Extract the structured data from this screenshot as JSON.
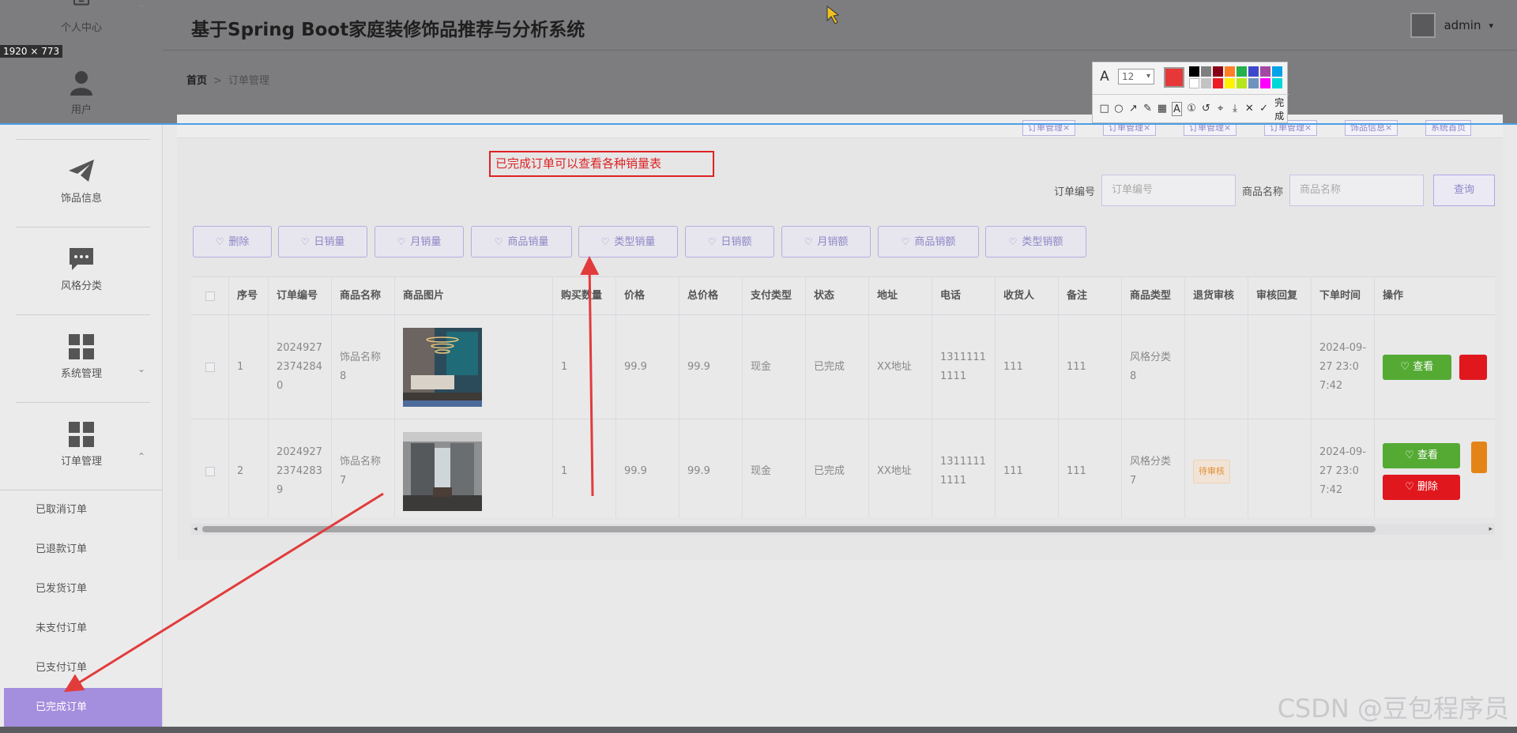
{
  "app": {
    "title": "基于Spring Boot家庭装修饰品推荐与分析系统",
    "user": "admin",
    "size_badge": "1920 × 773"
  },
  "breadcrumb": {
    "home": "首页",
    "separator": ">",
    "current": "订单管理"
  },
  "sidebar": {
    "items": [
      {
        "label": "个人中心",
        "icon": "monitor-icon"
      },
      {
        "label": "用户",
        "icon": "user-icon"
      },
      {
        "label": "饰品信息",
        "icon": "paper-plane-icon"
      },
      {
        "label": "风格分类",
        "icon": "chat-bubble-icon"
      },
      {
        "label": "系统管理",
        "icon": "grid-icon"
      },
      {
        "label": "订单管理",
        "icon": "grid-icon"
      }
    ],
    "sub_items": [
      "已取消订单",
      "已退款订单",
      "已发货订单",
      "未支付订单",
      "已支付订单",
      "已完成订单"
    ],
    "active_sub": "已完成订单"
  },
  "tabs": [
    "订单管理×",
    "订单管理×",
    "订单管理×",
    "订单管理×",
    "饰品信息×",
    "系统首页"
  ],
  "search": {
    "order_label": "订单编号",
    "order_placeholder": "订单编号",
    "product_label": "商品名称",
    "product_placeholder": "商品名称",
    "button": "查询"
  },
  "actions": [
    "删除",
    "日销量",
    "月销量",
    "商品销量",
    "类型销量",
    "日销额",
    "月销额",
    "商品销额",
    "类型销额"
  ],
  "table": {
    "headers": [
      "序号",
      "订单编号",
      "商品名称",
      "商品图片",
      "购买数量",
      "价格",
      "总价格",
      "支付类型",
      "状态",
      "地址",
      "电话",
      "收货人",
      "备注",
      "商品类型",
      "退货审核",
      "审核回复",
      "下单时间",
      "操作"
    ],
    "rows": [
      {
        "index": "1",
        "order_no": "20249272374284 0",
        "product": "饰品名称8",
        "qty": "1",
        "price": "99.9",
        "total": "99.9",
        "pay": "现金",
        "status": "已完成",
        "address": "XX地址",
        "phone": "13111111111",
        "receiver": "111",
        "remark": "111",
        "type": "风格分类8",
        "return_audit": "",
        "reply": "",
        "time": "2024-09-27 23:07:42",
        "view_btn": "查看"
      },
      {
        "index": "2",
        "order_no": "20249272374283 9",
        "product": "饰品名称7",
        "qty": "1",
        "price": "99.9",
        "total": "99.9",
        "pay": "现金",
        "status": "已完成",
        "address": "XX地址",
        "phone": "13111111111",
        "receiver": "111",
        "remark": "111",
        "type": "风格分类7",
        "return_audit": "待审核",
        "reply": "",
        "time": "2024-09-27 23:07:42",
        "view_btn": "查看",
        "delete_btn": "删除"
      }
    ]
  },
  "annotation": {
    "text": "已完成订单可以查看各种销量表"
  },
  "toolbar": {
    "font_size": "12",
    "done": "完成"
  },
  "watermark": "CSDN @豆包程序员",
  "colors": {
    "accent": "#a48ede",
    "green": "#55aa34",
    "red": "#e1171e",
    "annotation": "#dd2323"
  }
}
